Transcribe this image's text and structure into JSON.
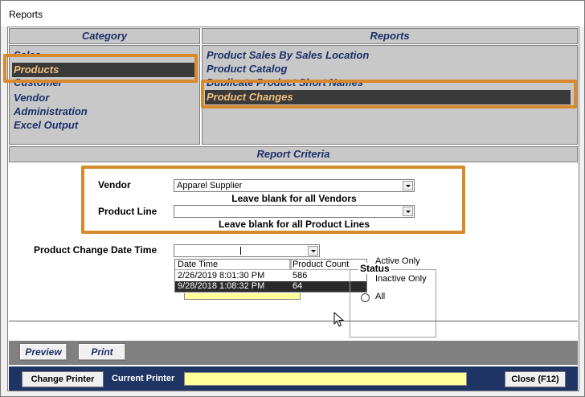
{
  "window": {
    "title": "Reports"
  },
  "category_panel": {
    "header": "Category",
    "items": [
      {
        "label": "Sales"
      },
      {
        "label": "Products",
        "selected": true
      },
      {
        "label": "Customer"
      },
      {
        "label": "Vendor"
      },
      {
        "label": "Administration"
      },
      {
        "label": "Excel Output"
      }
    ]
  },
  "reports_panel": {
    "header": "Reports",
    "items": [
      {
        "label": "Product Sales By Sales Location"
      },
      {
        "label": "Product Catalog"
      },
      {
        "label": "Duplicate Product Short Names"
      },
      {
        "label": "Product Changes",
        "selected": true
      }
    ]
  },
  "criteria": {
    "header": "Report Criteria",
    "vendor": {
      "label": "Vendor",
      "value": "Apparel Supplier",
      "hint": "Leave blank for all Vendors"
    },
    "product_line": {
      "label": "Product Line",
      "value": "",
      "hint": "Leave blank for all Product Lines"
    },
    "change_date": {
      "label": "Product Change Date Time",
      "value": "",
      "columns": [
        "Date Time",
        "Product Count"
      ],
      "rows": [
        {
          "date": "2/26/2019 8:01:30 PM",
          "count": "586",
          "selected": false
        },
        {
          "date": "9/28/2018 1:08:32 PM",
          "count": "64",
          "selected": true
        }
      ]
    },
    "status": {
      "legend": "Status",
      "options": [
        "Active Only",
        "Inactive Only",
        "All"
      ],
      "selected": "All"
    }
  },
  "buttons": {
    "preview": "Preview",
    "print": "Print",
    "change_printer": "Change Printer",
    "current_printer_label": "Current Printer",
    "current_printer_value": "",
    "close": "Close (F12)"
  },
  "colors": {
    "highlight": "#d7892c",
    "panel": "#c8c8c8",
    "label_blue": "#1d2f6b",
    "selected_text": "#f1c27d",
    "bottom_bar": "#1d3465",
    "printer_field": "#ffff99"
  }
}
